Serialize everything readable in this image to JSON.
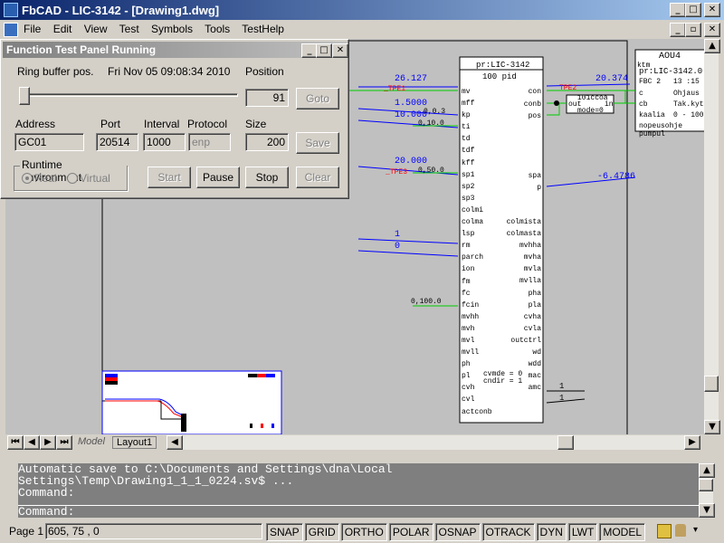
{
  "window": {
    "title": "FbCAD - LIC-3142 - [Drawing1.dwg]"
  },
  "menu": {
    "items": [
      "File",
      "Edit",
      "View",
      "Test",
      "Symbols",
      "Tools",
      "TestHelp"
    ]
  },
  "panel": {
    "title": "Function Test Panel Running",
    "ring_label": "Ring buffer pos.",
    "datetime": "Fri Nov 05 09:08:34 2010",
    "position_label": "Position",
    "position_value": "91",
    "goto_label": "Goto",
    "address_label": "Address",
    "address_value": "GC01",
    "port_label": "Port",
    "port_value": "20514",
    "interval_label": "Interval",
    "interval_value": "1000",
    "protocol_label": "Protocol",
    "protocol_value": "enp",
    "size_label": "Size",
    "size_value": "200",
    "save_label": "Save",
    "runtime_label": "Runtime environment",
    "real_label": "Real",
    "virtual_label": "Virtual",
    "start_label": "Start",
    "pause_label": "Pause",
    "stop_label": "Stop",
    "clear_label": "Clear"
  },
  "block": {
    "name": "pr:LIC-3142",
    "type": "100 pid",
    "left_pins": [
      "mv",
      "mff",
      "kp",
      "ti",
      "td",
      "tdf",
      "kff",
      "sp1",
      "sp2",
      "sp3",
      "colmi",
      "colma",
      "lsp",
      "rm",
      "parch",
      "ion",
      "fm",
      "fc",
      "fcin",
      "mvhh",
      "mvh",
      "mvl",
      "mvll",
      "ph",
      "pl",
      "cvh",
      "cvl",
      "actconb"
    ],
    "right_pins_top": [
      "con",
      "conb",
      "pos"
    ],
    "right_pins_mid": [
      "spa",
      "p"
    ],
    "right_pins_bottom": [
      "colmista",
      "colmasta",
      "mvhha",
      "mvha",
      "mvla",
      "mvlla",
      "pha",
      "pla",
      "cvha",
      "cvla",
      "outctrl",
      "wd",
      "wdd",
      "mac",
      "amc"
    ],
    "inner_text": [
      "cvmde = 0",
      "cndir = 1"
    ]
  },
  "signals": {
    "v1": "26.127",
    "v1_tag": "_TPE1",
    "v2": "1.5000",
    "v2_sub": "0,0.3",
    "v3": "10.000",
    "v3_sub": "0,10.0",
    "v4": "20.000",
    "v4_sub": "0,50.0",
    "v4_tag": "_TPE3",
    "v5": "1",
    "v6": "0",
    "v7": "0,100.0",
    "out1": "20.374",
    "out1_tag": "TPE2",
    "out2": "-6.4786",
    "mac_val": "1",
    "amc_val": "1"
  },
  "small_block": {
    "line1": "101ccoa",
    "left": "out",
    "right": "in",
    "line2": "mode=0"
  },
  "aou_block": {
    "title": "AOU4",
    "line1": "ktm",
    "line2": "pr:LIC-3142.0",
    "line3a": "FBC 2",
    "line3b": "13 :15",
    "line4a": "c",
    "line4b": "Ohjaus",
    "line5a": "cb",
    "line5b": "Tak.kyth",
    "line6a": "kaalia",
    "line6b": "0 - 100",
    "line7": "nopeusohje pumpul"
  },
  "tabs": {
    "model": "Model",
    "layout1": "Layout1"
  },
  "command": {
    "lines": [
      "Automatic save to C:\\Documents and Settings\\dna\\Local",
      "Settings\\Temp\\Drawing1_1_1_0224.sv$ ...",
      "Command:"
    ],
    "prompt": "Command:"
  },
  "status": {
    "page": "Page 1",
    "coords": "605, 75 , 0",
    "toggles": [
      "SNAP",
      "GRID",
      "ORTHO",
      "POLAR",
      "OSNAP",
      "OTRACK",
      "DYN",
      "LWT",
      "MODEL"
    ]
  },
  "colors": {
    "title_start": "#0a246a",
    "title_end": "#a6caf0",
    "canvas": "#c0c0c0",
    "cmd_bg": "#7f7f7f",
    "signal_blue": "#0000ff",
    "green": "#00cc00",
    "red": "#ff0000"
  }
}
